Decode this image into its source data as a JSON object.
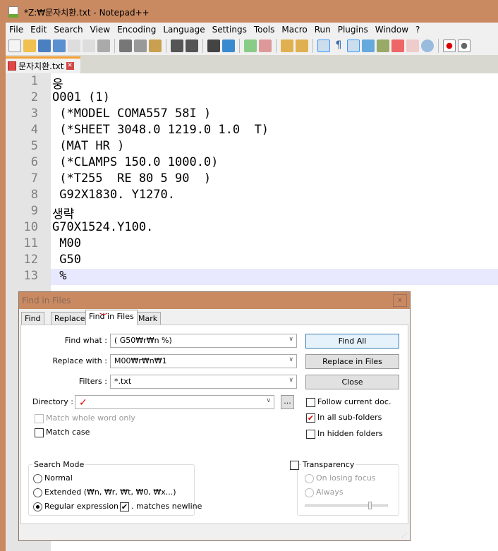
{
  "window": {
    "title": "*Z:₩문자치환.txt - Notepad++"
  },
  "menu": [
    "File",
    "Edit",
    "Search",
    "View",
    "Encoding",
    "Language",
    "Settings",
    "Tools",
    "Macro",
    "Run",
    "Plugins",
    "Window",
    "?"
  ],
  "tab": {
    "label": "문자치환.txt"
  },
  "editor": {
    "lines": [
      "웅",
      "O001 (1)",
      " (*MODEL COMA557 58I )",
      " (*SHEET 3048.0 1219.0 1.0  T)",
      " (MAT HR )",
      " (*CLAMPS 150.0 1000.0)",
      " (*T255  RE 80 5 90  )",
      " G92X1830. Y1270.",
      "생략",
      "G70X1524.Y100.",
      " M00",
      " G50",
      " %"
    ],
    "current_line": 13
  },
  "dialog": {
    "title": "Find in Files",
    "close": "x",
    "tabs": [
      "Find",
      "Replace",
      "Find in Files",
      "Mark"
    ],
    "active_tab": "Find in Files",
    "find_what_label": "Find what :",
    "find_what": "( G50₩r₩n %)",
    "replace_with_label": "Replace with :",
    "replace_with": "M00₩r₩n₩1",
    "filters_label": "Filters :",
    "filters": "*.txt",
    "directory_label": "Directory :",
    "directory": "",
    "browse": "...",
    "find_all": "Find All",
    "replace_in_files": "Replace in Files",
    "close_btn": "Close",
    "match_whole_word": "Match whole word only",
    "match_case": "Match case",
    "follow_current": "Follow current doc.",
    "sub_folders": "In all sub-folders",
    "hidden_folders": "In hidden folders",
    "search_mode": {
      "title": "Search Mode",
      "normal": "Normal",
      "extended": "Extended (₩n, ₩r, ₩t, ₩0, ₩x...)",
      "regex": "Regular expression",
      "selected": "regex",
      "matches_newline": ". matches newline"
    },
    "transparency": {
      "title": "Transparency",
      "on_losing_focus": "On losing focus",
      "always": "Always",
      "level": 0.78
    },
    "checked": {
      "sub_folders": true,
      "matches_newline": true,
      "follow_current": false,
      "hidden_folders": false,
      "match_case": false,
      "match_whole_word": false,
      "transparency": false
    }
  }
}
